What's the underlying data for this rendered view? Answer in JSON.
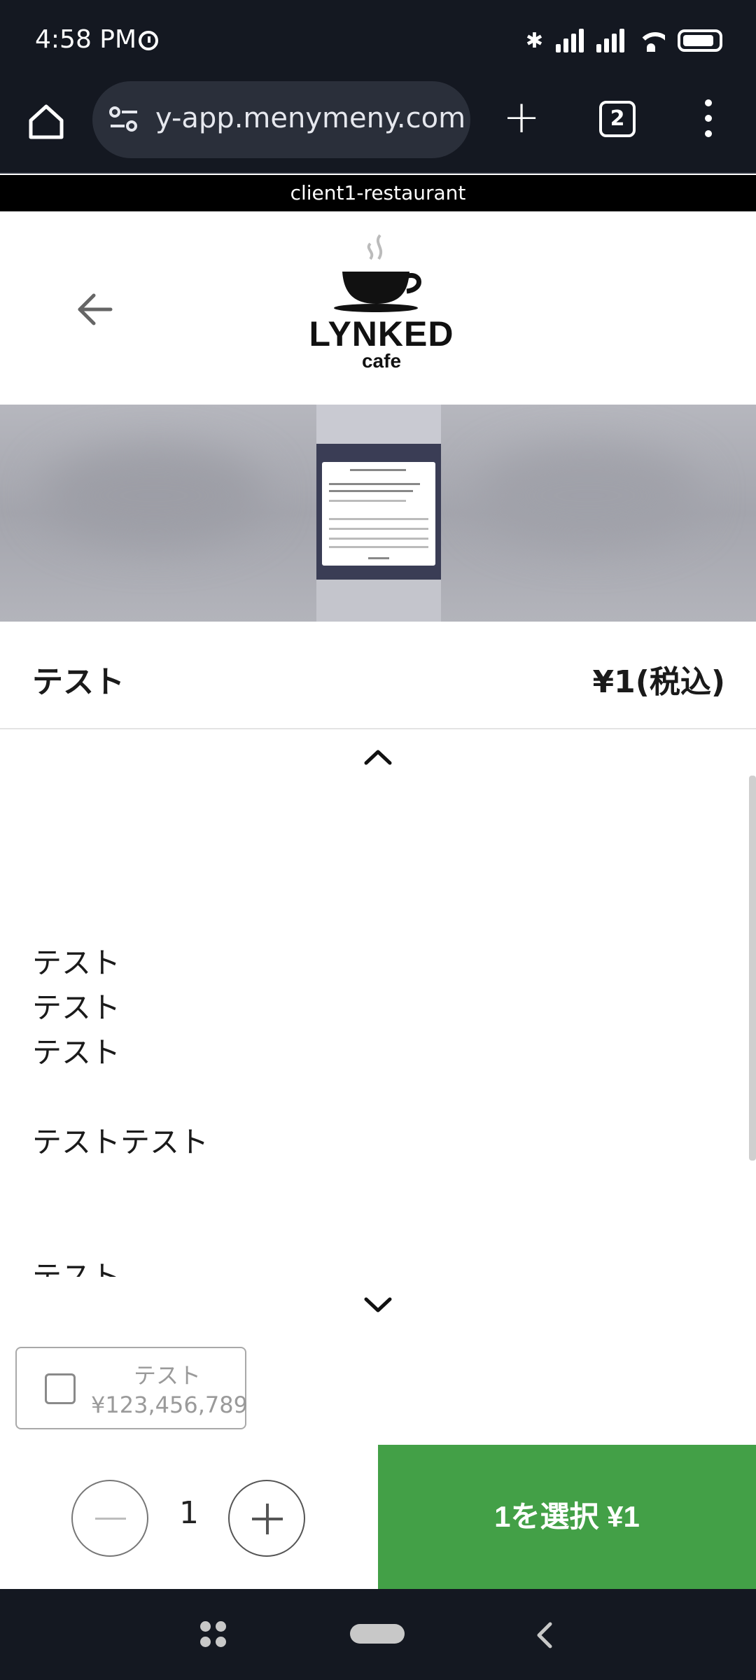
{
  "status_bar": {
    "time": "4:58 PM",
    "icons": [
      "alarm-icon",
      "bluetooth-icon",
      "signal-icon",
      "signal-icon",
      "wifi-icon",
      "battery-icon"
    ]
  },
  "browser": {
    "url": "y-app.menymeny.com",
    "tab_count": "2",
    "icons": [
      "home-icon",
      "site-settings-icon",
      "plus-icon",
      "more-vert-icon"
    ]
  },
  "restaurant_label": "client1-restaurant",
  "header": {
    "logo_text": "LYNKED",
    "logo_subtext": "cafe"
  },
  "product": {
    "name": "テスト",
    "price": "¥1(税込)",
    "description_lines": [
      "テスト",
      "テスト",
      "テスト",
      "",
      "テストテスト",
      "",
      "",
      "テスト"
    ]
  },
  "option": {
    "name": "テスト",
    "price": "¥123,456,789"
  },
  "order": {
    "quantity": "1",
    "select_label": "1を選択  ¥1"
  },
  "colors": {
    "system_bar": "#141821",
    "select_button": "#43a047",
    "restaurant_bar": "#000000"
  }
}
